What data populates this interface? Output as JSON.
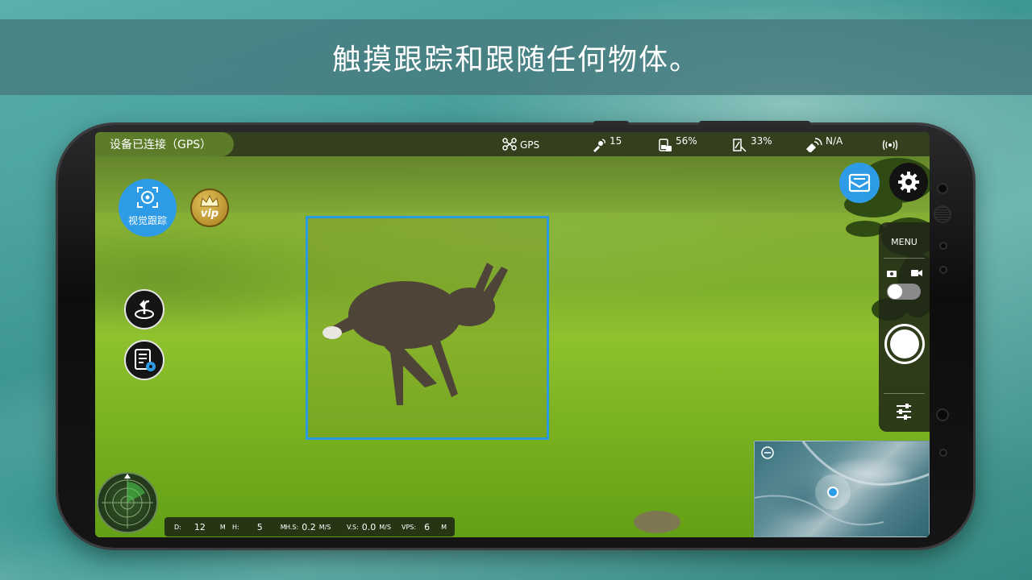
{
  "banner": {
    "headline": "触摸跟踪和跟随任何物体。"
  },
  "status": {
    "connection": "设备已连接（GPS）",
    "mode": "GPS",
    "satellites": "15",
    "drone_battery": "56%",
    "rc_battery": "33%",
    "signal": "N/A"
  },
  "controls": {
    "tracking_label": "视觉跟踪",
    "vip_label": "vip",
    "menu_label": "MENU",
    "capture_toggle": "photo",
    "accent_color": "#2d9be6"
  },
  "telemetry": {
    "d_label": "D:",
    "d_value": "12",
    "d_unit": "M",
    "h_label": "H:",
    "h_value": "5",
    "h_unit": "M",
    "hs_label": "H.S:",
    "hs_value": "0.2",
    "hs_unit": "M/S",
    "vs_label": "V.S:",
    "vs_value": "0.0",
    "vs_unit": "M/S",
    "vps_label": "VPS:",
    "vps_value": "6",
    "vps_unit": "M"
  },
  "icons": [
    "drone-icon",
    "satellite-icon",
    "drone-battery-icon",
    "rc-battery-icon",
    "rc-signal-icon",
    "wifi-icon",
    "track-target-icon",
    "crown-icon",
    "return-home-icon",
    "flight-log-icon",
    "message-icon",
    "gear-icon",
    "camera-icon",
    "video-icon",
    "sliders-icon",
    "radar-icon"
  ]
}
